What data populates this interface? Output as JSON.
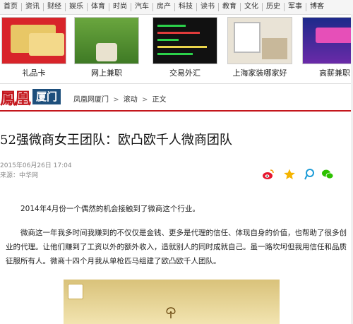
{
  "topnav": [
    "首页",
    "资讯",
    "财经",
    "娱乐",
    "体育",
    "时尚",
    "汽车",
    "房产",
    "科技",
    "读书",
    "教育",
    "文化",
    "历史",
    "军事",
    "博客"
  ],
  "ads": [
    {
      "caption": "礼品卡"
    },
    {
      "caption": "网上兼职"
    },
    {
      "caption": "交易外汇"
    },
    {
      "caption": "上海家装哪家好"
    },
    {
      "caption": "高薪兼职"
    }
  ],
  "logo": {
    "brand": "鳳凰",
    "city": "厦门"
  },
  "breadcrumb": {
    "home": "凤凰网厦门",
    "sep": ">",
    "section": "滚动",
    "current": "正文"
  },
  "article": {
    "title": "52强微商女王团队：欧凸欧千人微商团队",
    "date": "2015年06月26日 17:04",
    "source": "来源：中华网",
    "paragraphs": [
      "2014年4月份一个偶然的机会接触到了微商这个行业。",
      "微商这一年我多时间我赚到的不仅仅是金钱、更多是代理的信任、体现自身的价值，也帮助了很多创业的代理。让他们赚到了工资以外的额外收入，造就别人的同时成就自己。虽一路坎坷但我用信任和品质征服所有人。微商十四个月我从单枪匹马组建了欧凸欧千人团队。"
    ]
  },
  "share_icons": [
    "weibo-icon",
    "star-icon",
    "tencent-weibo-icon",
    "wechat-icon"
  ],
  "colors": {
    "brand_red": "#c4161c",
    "city_blue": "#1d4f7c"
  }
}
